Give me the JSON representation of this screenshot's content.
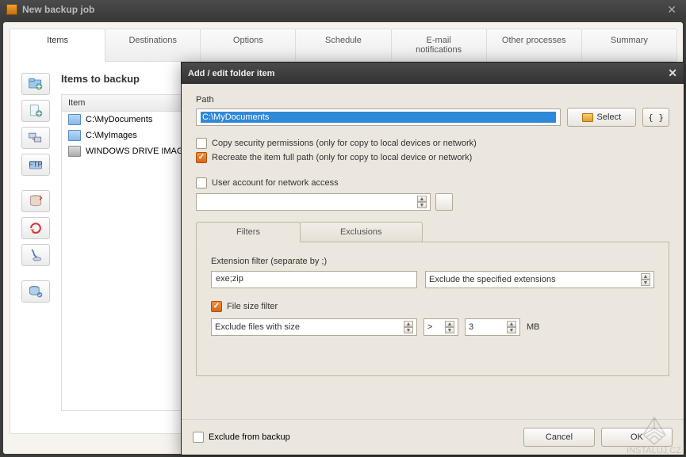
{
  "main": {
    "title": "New backup job",
    "tabs": [
      "Items",
      "Destinations",
      "Options",
      "Schedule",
      "E-mail notifications",
      "Other processes",
      "Summary"
    ],
    "activeTab": 0,
    "sectionTitle": "Items to backup",
    "listHeader": "Item",
    "items": [
      {
        "type": "folder",
        "label": "C:\\MyDocuments"
      },
      {
        "type": "folder",
        "label": "C:\\MyImages"
      },
      {
        "type": "disk",
        "label": "WINDOWS DRIVE IMAGE"
      }
    ]
  },
  "modal": {
    "title": "Add / edit folder item",
    "pathLabel": "Path",
    "pathValue": "C:\\MyDocuments",
    "selectBtn": "Select",
    "opt1": "Copy security permissions (only for copy to local devices or network)",
    "opt2": "Recreate the item full path (only for copy to local device or network)",
    "opt3": "User account for network access",
    "subTabs": [
      "Filters",
      "Exclusions"
    ],
    "extLabel": "Extension filter (separate by ;)",
    "extValue": "exe;zip",
    "extMode": "Exclude the specified extensions",
    "sizeFilterLabel": "File size filter",
    "sizeMode": "Exclude files with size",
    "sizeOp": ">",
    "sizeVal": "3",
    "sizeUnit": "MB",
    "excludeLabel": "Exclude from backup",
    "cancel": "Cancel",
    "ok": "OK"
  },
  "watermark": "INSTALUJ.CZ"
}
